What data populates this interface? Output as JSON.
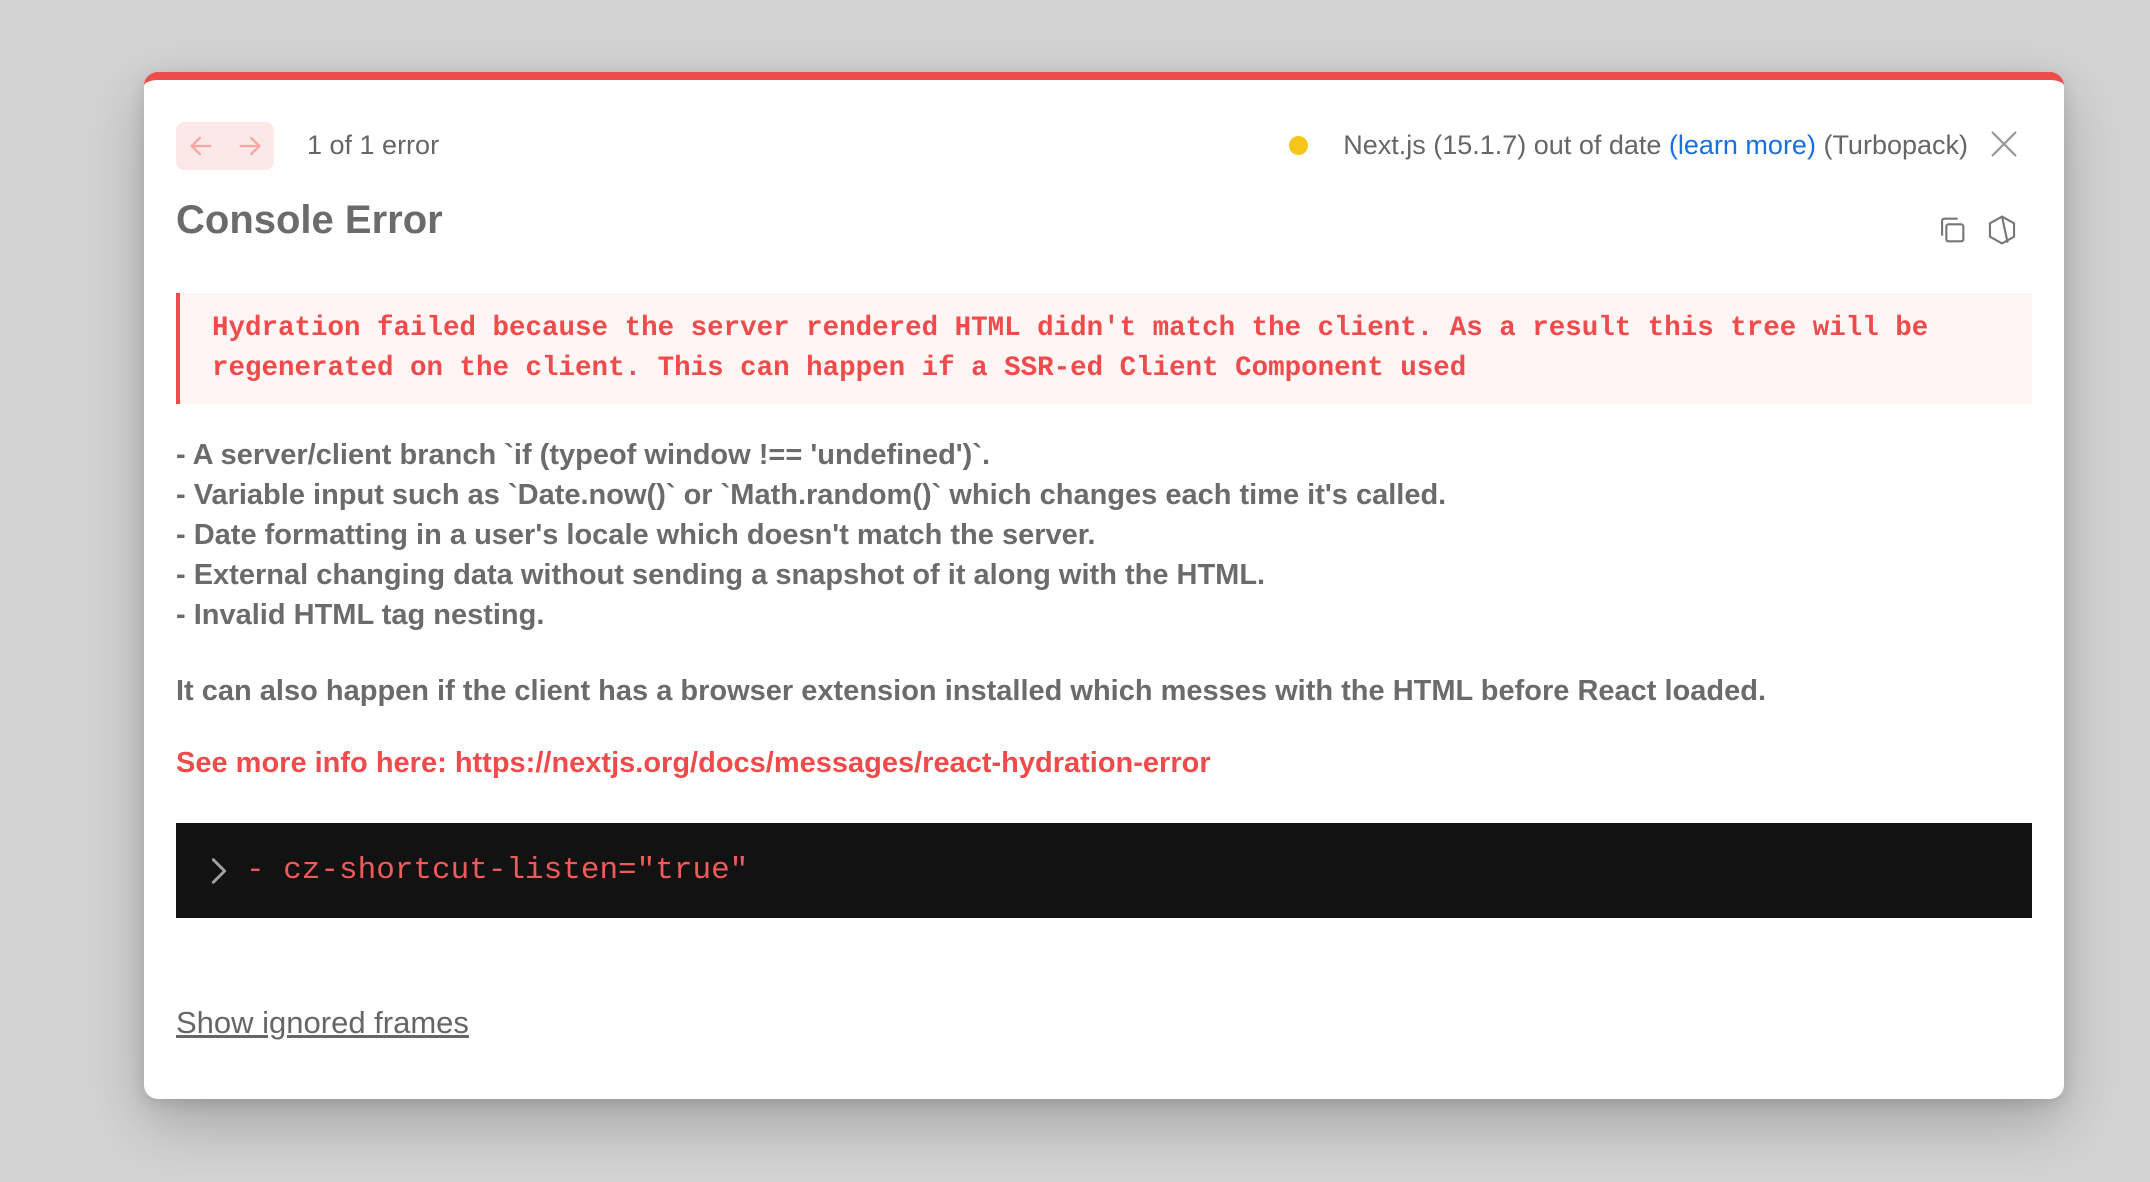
{
  "header": {
    "prev_icon": "arrow-left-icon",
    "next_icon": "arrow-right-icon",
    "pager_text": "1 of 1 error",
    "version_text": "Next.js (15.1.7) out of date ",
    "learn_more_label": "(learn more)",
    "bundler_text": " (Turbopack)",
    "status_color": "#f5c519",
    "close_icon": "close-icon"
  },
  "error": {
    "title": "Console Error",
    "copy_icon": "copy-icon",
    "nodejs_icon": "nodejs-icon",
    "message": "Hydration failed because the server rendered HTML didn't match the client. As a result this tree will be regenerated on the client. This can happen if a SSR-ed Client Component used",
    "causes": [
      "- A server/client branch `if (typeof window !== 'undefined')`.",
      "- Variable input such as `Date.now()` or `Math.random()` which changes each time it's called.",
      "- Date formatting in a user's locale which doesn't match the server.",
      "- External changing data without sending a snapshot of it along with the HTML.",
      "- Invalid HTML tag nesting."
    ],
    "extension_note": "It can also happen if the client has a browser extension installed which messes with the HTML before React loaded.",
    "more_info_prefix": "See more info here: ",
    "more_info_url": "https://nextjs.org/docs/messages/react-hydration-error",
    "diff_line": "- cz-shortcut-listen=\"true\"",
    "expand_icon": "chevron-right-icon",
    "show_ignored_label": "Show ignored frames"
  },
  "colors": {
    "accent_red": "#f04b4b",
    "link_blue": "#1a6fe0",
    "code_bg": "#121212"
  }
}
